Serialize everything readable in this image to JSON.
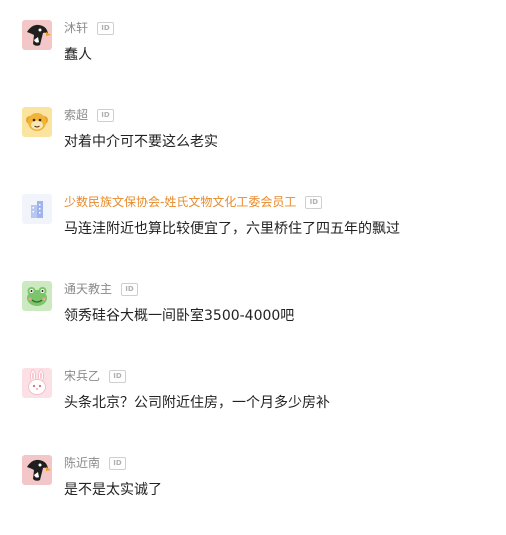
{
  "comments": [
    {
      "username": "沐轩",
      "id_badge": "ID",
      "text": "蠢人",
      "avatar_icon": "penguin-icon",
      "username_color": "#8a8a8a"
    },
    {
      "username": "索超",
      "id_badge": "ID",
      "text": "对着中介可不要这么老实",
      "avatar_icon": "monkey-icon",
      "username_color": "#8a8a8a"
    },
    {
      "username": "少数民族文保协会-姓氏文物文化工委会员工",
      "id_badge": "ID",
      "text": "马连洼附近也算比较便宜了，六里桥住了四五年的飘过",
      "avatar_icon": "building-icon",
      "username_color": "#e88a2a"
    },
    {
      "username": "通天教主",
      "id_badge": "ID",
      "text": "领秀硅谷大概一间卧室3500-4000吧",
      "avatar_icon": "frog-icon",
      "username_color": "#8a8a8a"
    },
    {
      "username": "宋兵乙",
      "id_badge": "ID",
      "text": "头条北京？公司附近住房，一个月多少房补",
      "avatar_icon": "rabbit-icon",
      "username_color": "#8a8a8a"
    },
    {
      "username": "陈近南",
      "id_badge": "ID",
      "text": "是不是太实诚了",
      "avatar_icon": "penguin-icon",
      "username_color": "#8a8a8a"
    }
  ]
}
